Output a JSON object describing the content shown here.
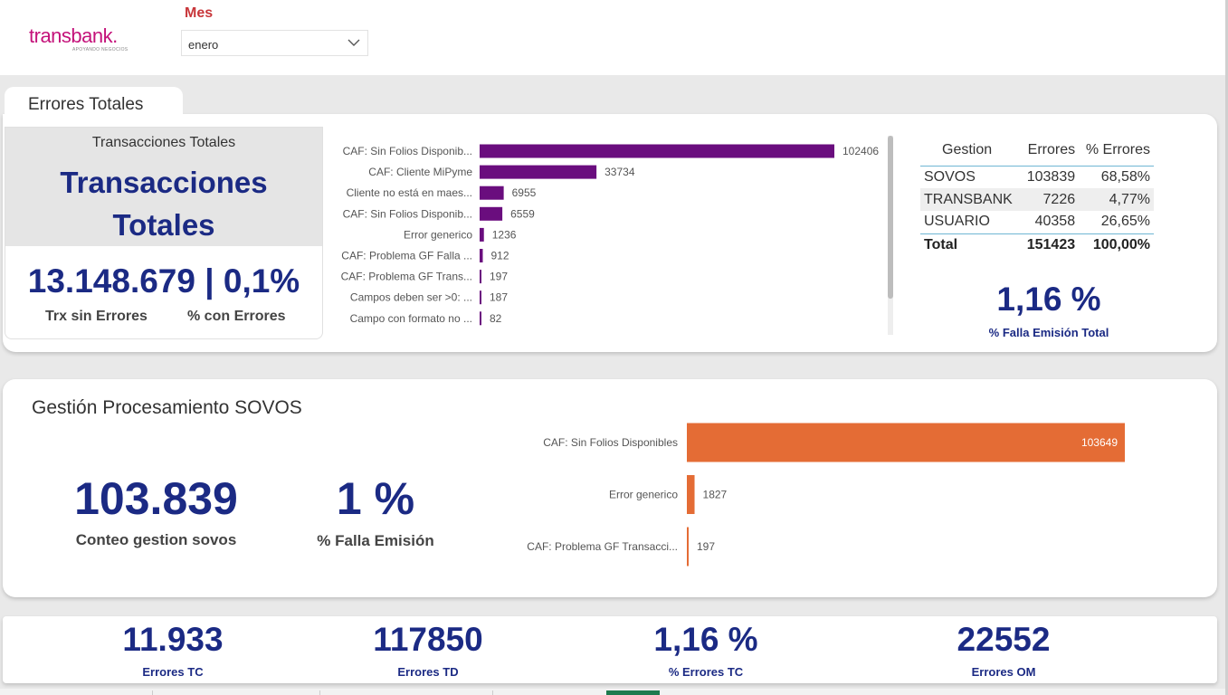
{
  "header": {
    "logo_text": "transbank.",
    "logo_tagline": "APOYANDO NEGOCIOS",
    "filter_label": "Mes",
    "filter_value": "enero"
  },
  "tab": {
    "label": "Errores Totales"
  },
  "kpi_card": {
    "small_title": "Transacciones Totales",
    "big_title_line1": "Transacciones",
    "big_title_line2": "Totales",
    "value": "13.148.679 | 0,1%",
    "label_left": "Trx sin Errores",
    "label_right": "% con Errores"
  },
  "chart_data": [
    {
      "type": "bar",
      "orientation": "horizontal",
      "categories": [
        "CAF: Sin Folios Disponib...",
        "CAF: Cliente MiPyme",
        "Cliente no está en maes...",
        "CAF: Sin Folios Disponib...",
        "Error generico",
        "CAF: Problema GF Falla ...",
        "CAF: Problema GF Trans...",
        "Campos deben ser >0: ...",
        "Campo con formato no ..."
      ],
      "values": [
        102406,
        33734,
        6955,
        6559,
        1236,
        912,
        197,
        187,
        82
      ],
      "color": "#6a0d7e"
    },
    {
      "type": "bar",
      "orientation": "horizontal",
      "categories": [
        "CAF: Sin Folios Disponibles",
        "Error generico",
        "CAF: Problema GF Transacci..."
      ],
      "values": [
        103649,
        1827,
        197
      ],
      "color": "#e46c35"
    }
  ],
  "table": {
    "headers": [
      "Gestion",
      "Errores",
      "% Errores"
    ],
    "rows": [
      [
        "SOVOS",
        "103839",
        "68,58%"
      ],
      [
        "TRANSBANK",
        "7226",
        "4,77%"
      ],
      [
        "USUARIO",
        "40358",
        "26,65%"
      ]
    ],
    "total": [
      "Total",
      "151423",
      "100,00%"
    ]
  },
  "falla_total": {
    "value": "1,16 %",
    "label": "% Falla Emisión Total"
  },
  "sovos": {
    "title": "Gestión Procesamiento SOVOS",
    "conteo_value": "103.839",
    "conteo_label": "Conteo gestion sovos",
    "falla_value": "1 %",
    "falla_label": "% Falla Emisión"
  },
  "bottom_kpis": [
    {
      "value": "11.933",
      "label": "Errores TC"
    },
    {
      "value": "117850",
      "label": "Errores TD"
    },
    {
      "value": "1,16 %",
      "label": "% Errores TC"
    },
    {
      "value": "22552",
      "label": "Errores OM"
    }
  ],
  "colors": {
    "navy": "#1b2a84",
    "purple": "#6a0d7e",
    "orange": "#e46c35",
    "brand": "#c4127a",
    "accent_red": "#c8363a"
  }
}
